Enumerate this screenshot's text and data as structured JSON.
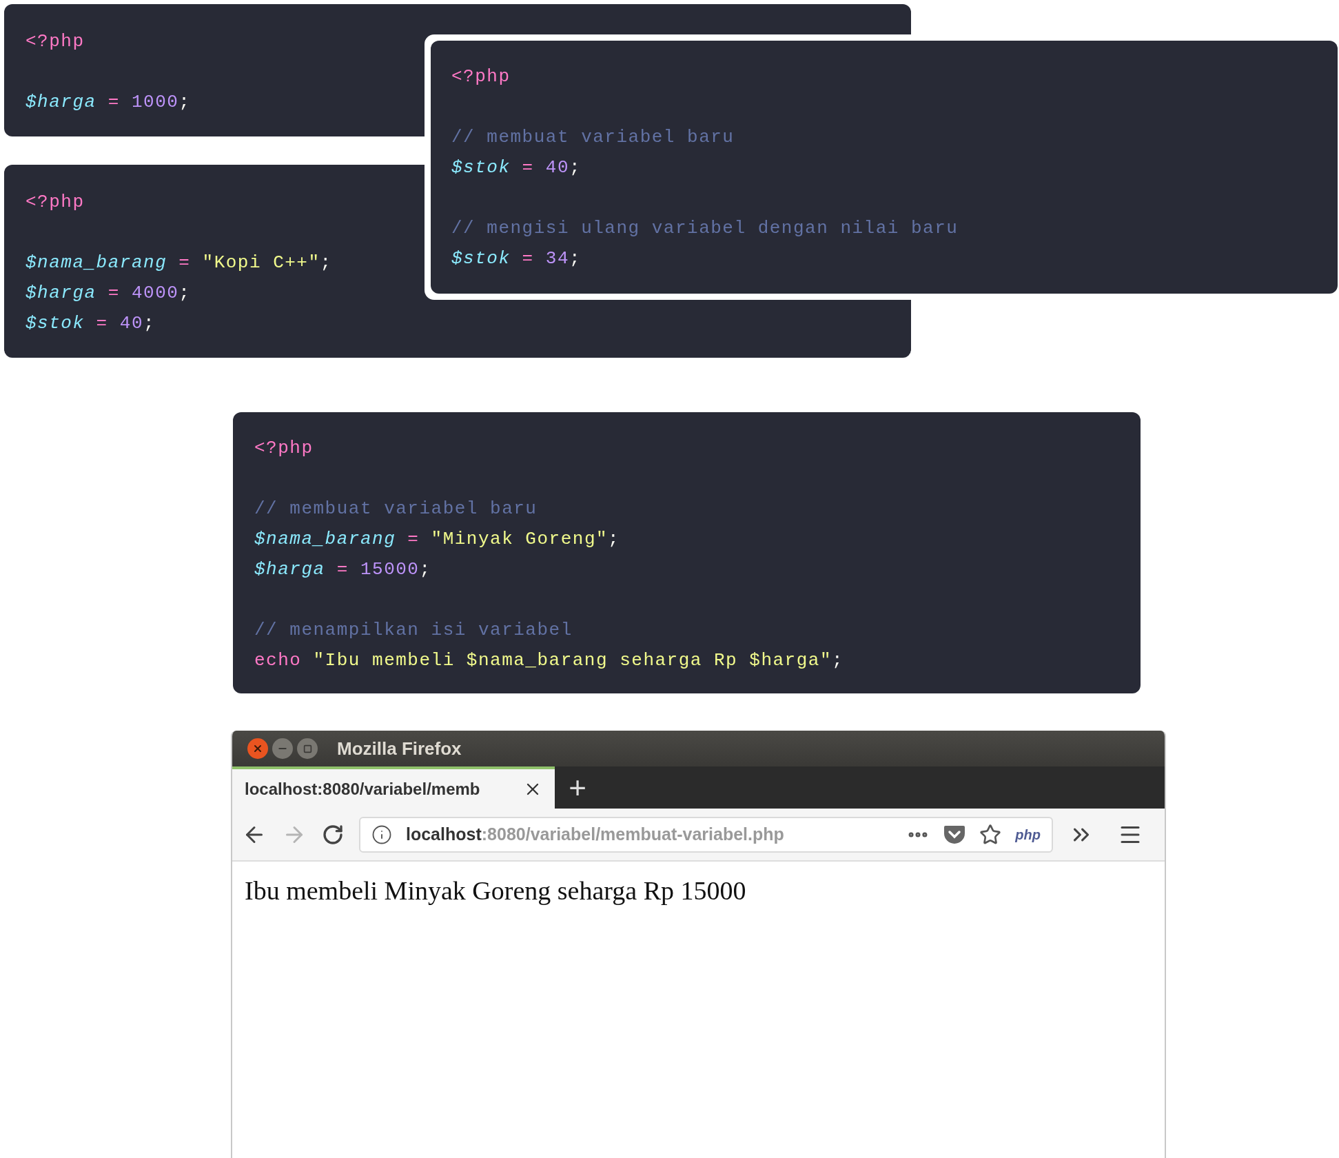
{
  "code_blocks": [
    {
      "kind": "plain",
      "lines": [
        {
          "kind": "code",
          "tokens": [
            {
              "kind": "tag",
              "text": "<?php"
            }
          ]
        },
        {
          "kind": "blank"
        },
        {
          "kind": "code",
          "tokens": [
            {
              "kind": "variable",
              "text": "$harga"
            },
            {
              "kind": "op",
              "text": " = "
            },
            {
              "kind": "number",
              "text": "1000"
            },
            {
              "kind": "punct",
              "text": ";"
            }
          ]
        }
      ]
    },
    {
      "kind": "plain",
      "lines": [
        {
          "kind": "code",
          "tokens": [
            {
              "kind": "tag",
              "text": "<?php"
            }
          ]
        },
        {
          "kind": "blank"
        },
        {
          "kind": "code",
          "tokens": [
            {
              "kind": "variable",
              "text": "$nama_barang"
            },
            {
              "kind": "op",
              "text": " = "
            },
            {
              "kind": "string",
              "text": "\"Kopi C++\""
            },
            {
              "kind": "punct",
              "text": ";"
            }
          ]
        },
        {
          "kind": "code",
          "tokens": [
            {
              "kind": "variable",
              "text": "$harga"
            },
            {
              "kind": "op",
              "text": " = "
            },
            {
              "kind": "number",
              "text": "4000"
            },
            {
              "kind": "punct",
              "text": ";"
            }
          ]
        },
        {
          "kind": "code",
          "tokens": [
            {
              "kind": "variable",
              "text": "$stok"
            },
            {
              "kind": "op",
              "text": " = "
            },
            {
              "kind": "number",
              "text": "40"
            },
            {
              "kind": "punct",
              "text": ";"
            }
          ]
        }
      ]
    },
    {
      "kind": "overlay",
      "lines": [
        {
          "kind": "code",
          "tokens": [
            {
              "kind": "tag",
              "text": "<?php"
            }
          ]
        },
        {
          "kind": "blank"
        },
        {
          "kind": "code",
          "tokens": [
            {
              "kind": "comment",
              "text": "// membuat variabel baru"
            }
          ]
        },
        {
          "kind": "code",
          "tokens": [
            {
              "kind": "variable",
              "text": "$stok"
            },
            {
              "kind": "op",
              "text": " = "
            },
            {
              "kind": "number",
              "text": "40"
            },
            {
              "kind": "punct",
              "text": ";"
            }
          ]
        },
        {
          "kind": "blank"
        },
        {
          "kind": "code",
          "tokens": [
            {
              "kind": "comment",
              "text": "// mengisi ulang variabel dengan nilai baru"
            }
          ]
        },
        {
          "kind": "code",
          "tokens": [
            {
              "kind": "variable",
              "text": "$stok"
            },
            {
              "kind": "op",
              "text": " = "
            },
            {
              "kind": "number",
              "text": "34"
            },
            {
              "kind": "punct",
              "text": ";"
            }
          ]
        }
      ]
    },
    {
      "kind": "centered",
      "lines": [
        {
          "kind": "code",
          "tokens": [
            {
              "kind": "tag",
              "text": "<?php"
            }
          ]
        },
        {
          "kind": "blank"
        },
        {
          "kind": "code",
          "tokens": [
            {
              "kind": "comment",
              "text": "// membuat variabel baru"
            }
          ]
        },
        {
          "kind": "code",
          "tokens": [
            {
              "kind": "variable",
              "text": "$nama_barang"
            },
            {
              "kind": "op",
              "text": " = "
            },
            {
              "kind": "string",
              "text": "\"Minyak Goreng\""
            },
            {
              "kind": "punct",
              "text": ";"
            }
          ]
        },
        {
          "kind": "code",
          "tokens": [
            {
              "kind": "variable",
              "text": "$harga"
            },
            {
              "kind": "op",
              "text": " = "
            },
            {
              "kind": "number",
              "text": "15000"
            },
            {
              "kind": "punct",
              "text": ";"
            }
          ]
        },
        {
          "kind": "blank"
        },
        {
          "kind": "code",
          "tokens": [
            {
              "kind": "comment",
              "text": "// menampilkan isi variabel"
            }
          ]
        },
        {
          "kind": "code",
          "tokens": [
            {
              "kind": "keyword",
              "text": "echo "
            },
            {
              "kind": "string",
              "text": "\"Ibu membeli $nama_barang seharga Rp $harga\""
            },
            {
              "kind": "punct",
              "text": ";"
            }
          ]
        }
      ]
    }
  ],
  "browser": {
    "window": {
      "title": "Mozilla Firefox"
    },
    "tabs": [
      {
        "label": "localhost:8080/variabel/memb",
        "selected": true
      }
    ],
    "new_tab": "+",
    "nav": {
      "back": {
        "disabled": false
      },
      "forward": {
        "disabled": true
      }
    },
    "url": {
      "host": "localhost",
      "rest": ":8080/variabel/membuat-variabel.php"
    },
    "extension": "php",
    "content": "Ibu membeli Minyak Goreng seharga Rp 15000"
  }
}
